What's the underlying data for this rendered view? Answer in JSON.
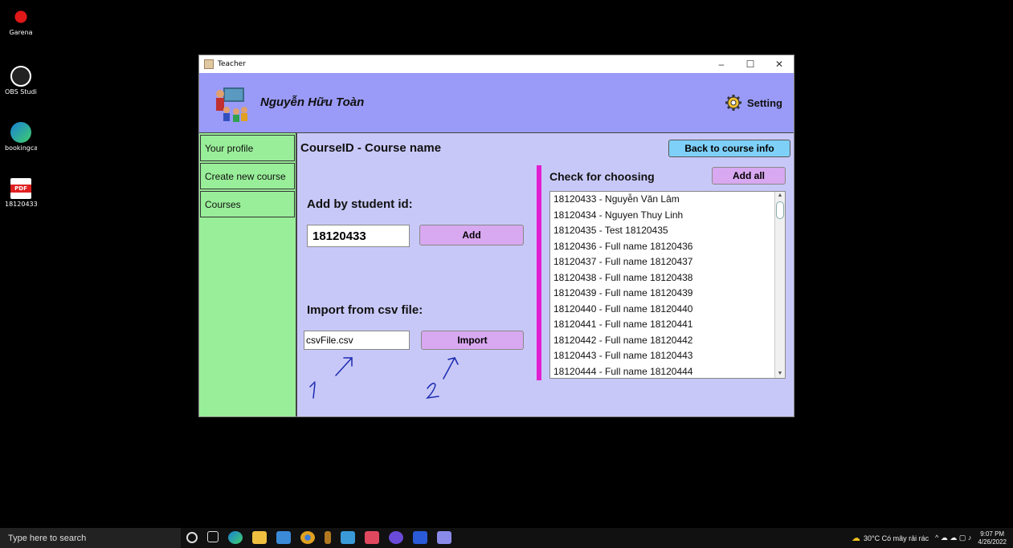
{
  "desktop": {
    "icons": [
      {
        "label": "Garena",
        "icon": "garena-icon",
        "color": "#e01818"
      },
      {
        "label": "OBS Studio",
        "icon": "obs-icon",
        "color": "#333333"
      },
      {
        "label": "bookingcar...",
        "icon": "edge-icon",
        "color": "#1a7fd8"
      },
      {
        "label": "18120433",
        "icon": "pdf-icon",
        "color": "#e02020"
      }
    ]
  },
  "window": {
    "title": "Teacher",
    "controls": {
      "minimize": "–",
      "maximize": "☐",
      "close": "✕"
    }
  },
  "header": {
    "user_name": "Nguyễn Hữu Toàn",
    "setting_label": "Setting",
    "bg_color": "#9a9af8"
  },
  "sidebar": {
    "items": [
      {
        "label": "Your profile"
      },
      {
        "label": "Create new course"
      },
      {
        "label": "Courses"
      }
    ],
    "color": "#99ee99"
  },
  "main": {
    "course_title": "CourseID - Course name",
    "back_button": "Back to course info",
    "add_by_id_label": "Add by student id:",
    "student_id_value": "18120433",
    "add_button": "Add",
    "import_label": "Import from csv file:",
    "csv_value": "csvFile.csv",
    "import_button": "Import",
    "annotation_1": "1",
    "annotation_2": "2"
  },
  "check_panel": {
    "title": "Check for choosing",
    "add_all_button": "Add all",
    "students": [
      "18120433 - Nguyễn Văn Lâm",
      "18120434 - Nguyen Thuy Linh",
      "18120435 - Test 18120435",
      "18120436 - Full name 18120436",
      "18120437 - Full name 18120437",
      "18120438 - Full name 18120438",
      "18120439 - Full name 18120439",
      "18120440 - Full name 18120440",
      "18120441 - Full name 18120441",
      "18120442 - Full name 18120442",
      "18120443 - Full name 18120443",
      "18120444 - Full name 18120444"
    ]
  },
  "taskbar": {
    "search_placeholder": "Type here to search",
    "weather": "30°C Có mây rải rác",
    "time": "9:07 PM",
    "date": "4/26/2022"
  }
}
